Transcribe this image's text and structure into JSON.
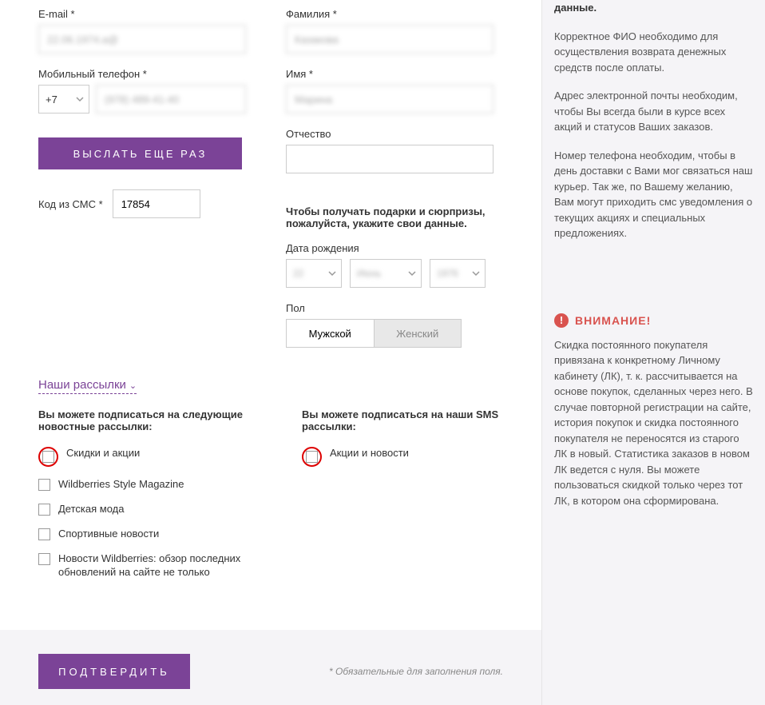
{
  "form": {
    "email": {
      "label": "E-mail *",
      "value": "22.06.1974.a@"
    },
    "phone": {
      "label": "Мобильный телефон *",
      "code": "+7",
      "value": "(978) 489-41-40"
    },
    "resend_button": "ВЫСЛАТЬ ЕЩЕ РАЗ",
    "sms_code": {
      "label": "Код из СМС *",
      "value": "17854"
    },
    "lastname": {
      "label": "Фамилия *",
      "value": "Казакова"
    },
    "firstname": {
      "label": "Имя *",
      "value": "Марина"
    },
    "middlename": {
      "label": "Отчество",
      "value": ""
    },
    "gifts_prompt": "Чтобы получать подарки и сюрпризы, пожалуйста, укажите свои данные.",
    "birthdate": {
      "label": "Дата рождения",
      "day": "22",
      "month": "Июнь",
      "year": "1976"
    },
    "gender": {
      "label": "Пол",
      "male": "Мужской",
      "female": "Женский"
    }
  },
  "newsletters": {
    "header": "Наши рассылки",
    "news_title": "Вы можете подписаться на следующие новостные рассылки:",
    "sms_title": "Вы можете подписаться на наши SMS рассылки:",
    "news_items": [
      "Скидки и акции",
      "Wildberries Style Magazine",
      "Детская мода",
      "Спортивные новости",
      "Новости Wildberries: обзор последних обновлений на сайте не только"
    ],
    "sms_items": [
      "Акции и новости"
    ]
  },
  "footer": {
    "confirm_button": "ПОДТВЕРДИТЬ",
    "required_note": "* Обязательные для заполнения поля."
  },
  "sidebar": {
    "lead": "данные.",
    "para1": "Корректное ФИО необходимо для осуществления возврата денежных средств после оплаты.",
    "para2": "Адрес электронной почты необходим, чтобы Вы всегда были в курсе всех акций и статусов Ваших заказов.",
    "para3": "Номер телефона необходим, чтобы в день доставки с Вами мог связаться наш курьер. Так же, по Вашему желанию, Вам могут приходить смс уведомления о текущих акциях и специальных предложениях.",
    "attention_title": "ВНИМАНИЕ!",
    "attention_text": "Скидка постоянного покупателя привязана к конкретному Личному кабинету (ЛК), т. к. рассчитывается на основе покупок, сделанных через него. В случае повторной регистрации на сайте, история покупок и скидка постоянного покупателя не переносятся из старого ЛК в новый. Статистика заказов в новом ЛК ведется с нуля. Вы можете пользоваться скидкой только через тот ЛК, в котором она сформирована."
  }
}
